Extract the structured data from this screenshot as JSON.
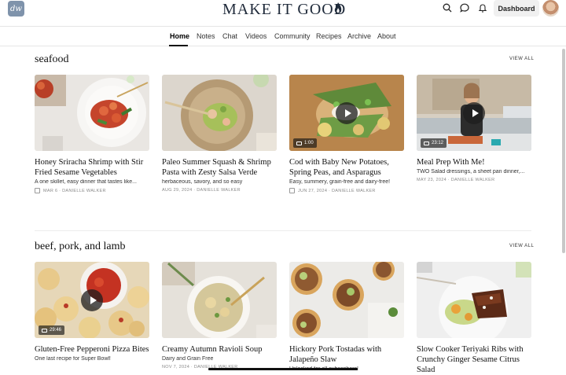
{
  "header": {
    "logo_initials": "dw",
    "site_title": "MAKE IT GOOD",
    "dashboard_label": "Dashboard"
  },
  "nav": {
    "items": [
      "Home",
      "Notes",
      "Chat",
      "Videos",
      "Community",
      "Recipes",
      "Archive",
      "About"
    ],
    "active": "Home"
  },
  "sections": [
    {
      "title": "seafood",
      "view_all": "VIEW ALL",
      "cards": [
        {
          "title": "Honey Sriracha Shrimp with Stir Fried Sesame Vegetables",
          "subtitle": "A one skillet, easy dinner that tastes like...",
          "meta": "MAR 6 · DANIELLE WALKER",
          "locked": true,
          "duration": ""
        },
        {
          "title": "Paleo Summer Squash & Shrimp Pasta with Zesty Salsa Verde",
          "subtitle": "herbaceous, savory, and so easy",
          "meta": "AUG 29, 2024 · DANIELLE WALKER",
          "locked": false,
          "duration": ""
        },
        {
          "title": "Cod with Baby New Potatoes, Spring Peas, and Asparagus",
          "subtitle": "Easy, summery, grain-free and dairy-free!",
          "meta": "JUN 27, 2024 · DANIELLE WALKER",
          "locked": true,
          "duration": "1:00"
        },
        {
          "title": "Meal Prep With Me!",
          "subtitle": "TWO Salad dressings, a sheet pan dinner,...",
          "meta": "MAY 23, 2024 · DANIELLE WALKER",
          "locked": false,
          "duration": "23:12"
        }
      ]
    },
    {
      "title": "beef, pork, and lamb",
      "view_all": "VIEW ALL",
      "cards": [
        {
          "title": "Gluten-Free Pepperoni Pizza Bites",
          "subtitle": "One last recipe for Super Bowl!",
          "meta": "",
          "locked": false,
          "duration": "29:46"
        },
        {
          "title": "Creamy Autumn Ravioli Soup",
          "subtitle": "Dairy and Grain Free",
          "meta": "NOV 7, 2024 · DANIELLE WALKER",
          "locked": false,
          "duration": ""
        },
        {
          "title": "Hickory Pork Tostadas with Jalapeño Slaw",
          "subtitle": "Unlocked for all subscribers!",
          "meta": "",
          "locked": false,
          "duration": ""
        },
        {
          "title": "Slow Cooker Teriyaki Ribs with Crunchy Ginger Sesame Citrus Salad",
          "subtitle": "",
          "meta": "",
          "locked": false,
          "duration": ""
        }
      ]
    }
  ],
  "colors": {
    "logo_badge": "#7f93ab",
    "title_text": "#1f2a3a",
    "dashboard_bg": "#f0f0f0"
  }
}
